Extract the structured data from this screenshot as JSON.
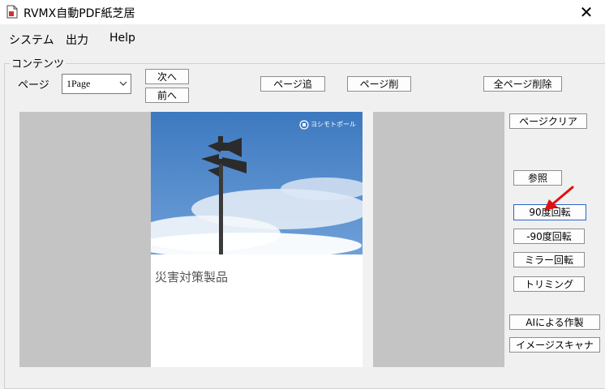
{
  "window": {
    "title": "RVMX自動PDF紙芝居",
    "close_label": "✕"
  },
  "menu": {
    "system": "システム",
    "output": "出力",
    "help": "Help"
  },
  "content_group": {
    "legend": "コンテンツ",
    "page_label": "ページ",
    "page_select_value": "1Page",
    "next_label": "次へ",
    "prev_label": "前へ",
    "add_page_label": "ページ追",
    "delete_page_label": "ページ削",
    "delete_all_label": "全ページ削除"
  },
  "side_buttons": {
    "page_clear": "ページクリア",
    "browse": "参照",
    "rotate_90": "90度回転",
    "rotate_minus_90": "-90度回転",
    "mirror_rotate": "ミラー回転",
    "trimming": "トリミング",
    "ai_create": "AIによる作製",
    "image_scanner": "イメージスキャナ"
  },
  "document": {
    "heading": "災害対策製品",
    "brand": "ヨシモトポール"
  },
  "icons": {
    "app": "document-icon",
    "select_arrow": "chevron-down-icon",
    "annotation": "red-arrow-icon"
  },
  "colors": {
    "annotation_arrow": "#e01010",
    "sky": "#4f86c6",
    "focused_border": "#2a64c8"
  }
}
